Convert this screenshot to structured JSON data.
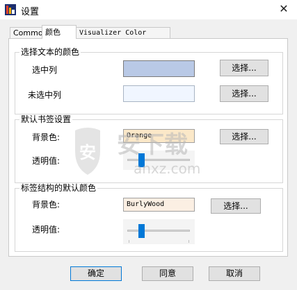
{
  "window": {
    "title": "设置",
    "close_symbol": "✕"
  },
  "tabs": [
    {
      "label": "Common"
    },
    {
      "label": "颜色"
    },
    {
      "label": "Visualizer Color Maps"
    }
  ],
  "active_tab": "颜色",
  "text_colors": {
    "title": "选择文本的颜色",
    "selected_label": "选中列",
    "selected_color": "#b9c9e6",
    "unselected_label": "未选中列",
    "unselected_color": "#f0f6ff",
    "choose_label": "选择..."
  },
  "bookmark_settings": {
    "title": "默认书签设置",
    "bg_label": "背景色:",
    "bg_value": "Orange",
    "bg_color": "#fbe8c8",
    "alpha_label": "透明值:",
    "alpha_fraction": 0.2,
    "choose_label": "选择..."
  },
  "tag_defaults": {
    "title": "标签结构的默认颜色",
    "bg_label": "背景色:",
    "bg_value": "BurlyWood",
    "bg_color": "#fbefe3",
    "alpha_label": "透明值:",
    "alpha_fraction": 0.2,
    "choose_label": "选择..."
  },
  "footer": {
    "ok_label": "确定",
    "agree_label": "同意",
    "cancel_label": "取消"
  },
  "watermark": {
    "text": "安下载",
    "subtext": "anxz.com",
    "logo_char": "安",
    "color": "#b8b8b8"
  },
  "accent_color": "#0078d7"
}
